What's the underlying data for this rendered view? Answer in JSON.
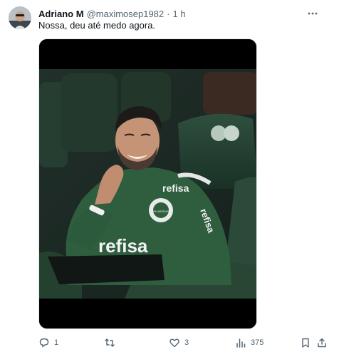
{
  "tweet": {
    "author_name": "Adriano M",
    "author_handle": "@maximosep1982",
    "separator": "·",
    "time": "1 h",
    "text": "Nossa, deu até medo agora.",
    "media": {
      "jersey_sponsor": "refisa",
      "jersey_sleeve_text": "refisa",
      "crest_text": "PALMEIRAS"
    },
    "actions": {
      "reply_icon": "reply-icon",
      "reply_count": "1",
      "retweet_icon": "retweet-icon",
      "retweet_count": "",
      "like_icon": "heart-icon",
      "like_count": "3",
      "views_icon": "views-icon",
      "views_count": "375",
      "bookmark_icon": "bookmark-icon",
      "share_icon": "share-icon"
    }
  },
  "colors": {
    "text_primary": "#0f1419",
    "text_secondary": "#536471",
    "jersey_green": "#2f5e3f"
  }
}
